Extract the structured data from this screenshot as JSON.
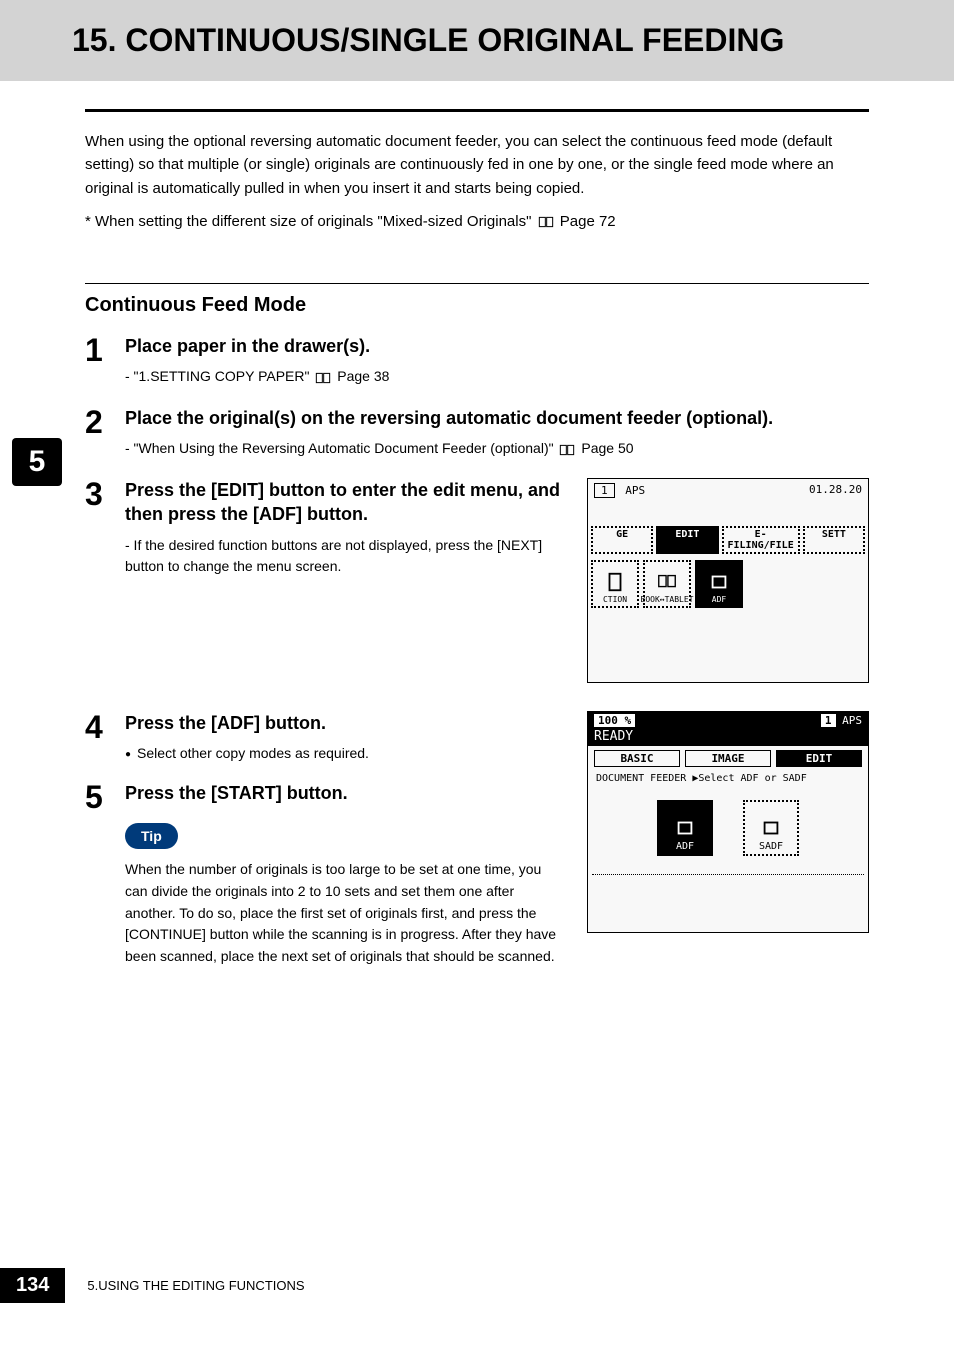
{
  "title": "15. CONTINUOUS/SINGLE ORIGINAL FEEDING",
  "intro": "When using the optional reversing automatic document feeder, you can select the continuous feed mode (default setting) so that multiple (or single) originals are continuously fed in one by one, or the single feed mode where an original is automatically pulled in when you insert it and starts being copied.",
  "intro_note_prefix": "*  When setting the different size of originals \"Mixed-sized Originals\" ",
  "intro_note_suffix": " Page 72",
  "section_heading": "Continuous Feed Mode",
  "side_tab": "5",
  "steps": {
    "s1": {
      "num": "1",
      "title": "Place paper in the drawer(s).",
      "sub_prefix": "-   \"1.SETTING COPY PAPER\" ",
      "sub_suffix": " Page 38"
    },
    "s2": {
      "num": "2",
      "title": "Place the original(s) on the reversing automatic document feeder (optional).",
      "sub_prefix": "-   \"When Using the Reversing Automatic Document Feeder (optional)\" ",
      "sub_suffix": " Page 50"
    },
    "s3": {
      "num": "3",
      "title": "Press the [EDIT] button to enter the edit menu, and then press the [ADF] button.",
      "sub": "-   If the desired function buttons are not displayed, press the [NEXT] button to change the menu screen."
    },
    "s4": {
      "num": "4",
      "title": "Press the [ADF] button.",
      "bullet": "Select other copy modes as required."
    },
    "s5": {
      "num": "5",
      "title": "Press the [START] button."
    }
  },
  "tip": {
    "label": "Tip",
    "text": "When the number of originals is too large to be set at one time, you can divide the originals into 2 to 10 sets and set them one after another. To do so, place the first set of originals first, and press the [CONTINUE] button while the scanning is in progress. After they have been scanned, place the next set of originals that should be scanned."
  },
  "screenshot1": {
    "count": "1",
    "aps": "APS",
    "time": "01.28.20",
    "tab_ge": "GE",
    "tab_edit": "EDIT",
    "tab_efiling": "E-FILING/FILE",
    "tab_sett": "SETT",
    "icon_ction": "CTION",
    "icon_book": "BOOK↔TABLET",
    "icon_adf": "ADF"
  },
  "screenshot2": {
    "percent": "100  %",
    "count": "1",
    "aps": "APS",
    "ready": "READY",
    "tab_basic": "BASIC",
    "tab_image": "IMAGE",
    "tab_edit": "EDIT",
    "sub_label": "DOCUMENT FEEDER  ▶Select ADF or SADF",
    "opt_adf": "ADF",
    "opt_sadf": "SADF"
  },
  "footer": {
    "page": "134",
    "chapter": "5.USING THE EDITING FUNCTIONS"
  }
}
